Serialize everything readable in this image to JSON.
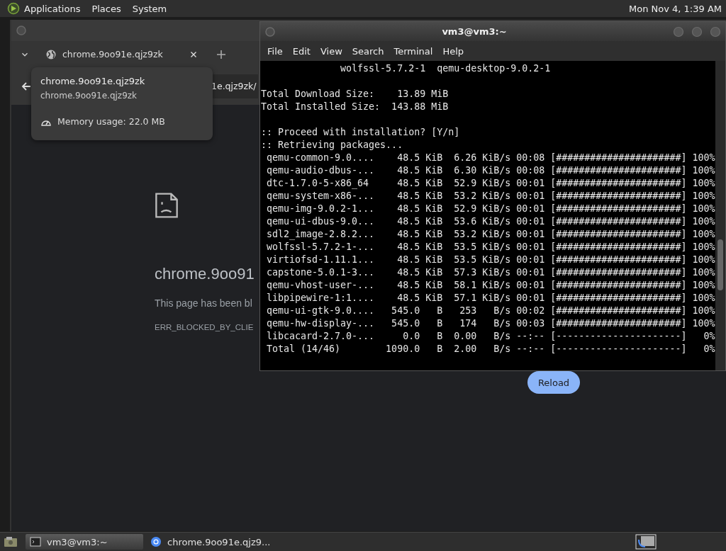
{
  "top_panel": {
    "menus": [
      "Applications",
      "Places",
      "System"
    ],
    "clock": "Mon Nov 4, 1:39 AM"
  },
  "browser_window": {
    "tab": {
      "title": "chrome.9oo91e.qjz9zk"
    },
    "address": {
      "value": "1e.qjz9zk/"
    },
    "hover_card": {
      "title": "chrome.9oo91e.qjz9zk",
      "subtitle": "chrome.9oo91e.qjz9zk",
      "memory": "Memory usage: 22.0 MB"
    },
    "error_page": {
      "heading": "chrome.9oo91",
      "message": "This page has been bl",
      "code": "ERR_BLOCKED_BY_CLIE",
      "button": "Reload"
    }
  },
  "terminal_window": {
    "title": "vm3@vm3:~",
    "menus": [
      "File",
      "Edit",
      "View",
      "Search",
      "Terminal",
      "Help"
    ],
    "blocks": [
      [
        "              wolfssl-5.7.2-1  qemu-desktop-9.0.2-1"
      ],
      [
        "Total Download Size:    13.89 MiB",
        "Total Installed Size:  143.88 MiB"
      ],
      [
        ":: Proceed with installation? [Y/n]",
        ":: Retrieving packages...",
        " qemu-common-9.0....    48.5 KiB  6.26 KiB/s 00:08 [######################] 100%",
        " qemu-audio-dbus-...    48.5 KiB  6.30 KiB/s 00:08 [######################] 100%",
        " dtc-1.7.0-5-x86_64     48.5 KiB  52.9 KiB/s 00:01 [######################] 100%",
        " qemu-system-x86-...    48.5 KiB  53.2 KiB/s 00:01 [######################] 100%",
        " qemu-img-9.0.2-1...    48.5 KiB  52.9 KiB/s 00:01 [######################] 100%",
        " qemu-ui-dbus-9.0...    48.5 KiB  53.6 KiB/s 00:01 [######################] 100%",
        " sdl2_image-2.8.2...    48.5 KiB  53.2 KiB/s 00:01 [######################] 100%",
        " wolfssl-5.7.2-1-...    48.5 KiB  53.5 KiB/s 00:01 [######################] 100%",
        " virtiofsd-1.11.1...    48.5 KiB  53.5 KiB/s 00:01 [######################] 100%",
        " capstone-5.0.1-3...    48.5 KiB  57.3 KiB/s 00:01 [######################] 100%",
        " qemu-vhost-user-...    48.5 KiB  58.1 KiB/s 00:01 [######################] 100%",
        " libpipewire-1:1....    48.5 KiB  57.1 KiB/s 00:01 [######################] 100%",
        " qemu-ui-gtk-9.0....   545.0   B   253   B/s 00:02 [######################] 100%",
        " qemu-hw-display-...   545.0   B   174   B/s 00:03 [######################] 100%",
        " libcacard-2.7.0-...     0.0   B  0.00   B/s --:-- [----------------------]   0%",
        " Total (14/46)        1090.0   B  2.00   B/s --:-- [----------------------]   0%"
      ]
    ]
  },
  "taskbar": {
    "items": [
      {
        "kind": "terminal",
        "label": "vm3@vm3:~",
        "selected": true
      },
      {
        "kind": "browser",
        "label": "chrome.9oo91e.qjz9...",
        "selected": false
      }
    ]
  }
}
